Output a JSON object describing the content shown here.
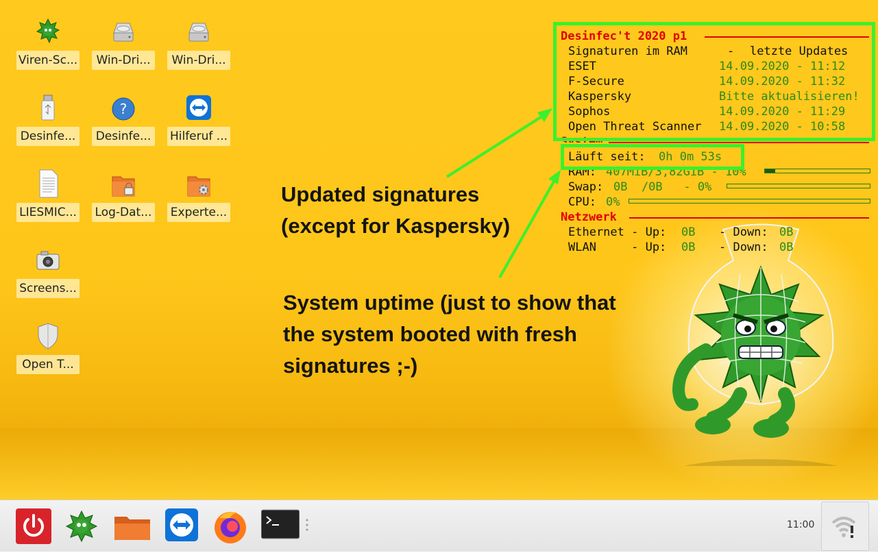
{
  "desktop_icons": [
    {
      "label": "Viren-Sc...",
      "icon": "virus-mascot-icon"
    },
    {
      "label": "Win-Dri...",
      "icon": "hard-drive-icon"
    },
    {
      "label": "Win-Dri...",
      "icon": "hard-drive-icon"
    },
    {
      "label": "Desinfe...",
      "icon": "usb-stick-icon"
    },
    {
      "label": "Desinfe...",
      "icon": "help-icon"
    },
    {
      "label": "Hilferuf ...",
      "icon": "teamviewer-icon"
    },
    {
      "label": "LIESMIC...",
      "icon": "text-document-icon"
    },
    {
      "label": "Log-Dat...",
      "icon": "locked-folder-icon"
    },
    {
      "label": "Experte...",
      "icon": "settings-folder-icon"
    },
    {
      "label": "Screens...",
      "icon": "camera-icon"
    },
    {
      "label": "Open T...",
      "icon": "shield-icon"
    }
  ],
  "conky": {
    "title": "Desinfec't 2020 p1",
    "sig_header_left": "Signaturen im RAM",
    "sig_header_sep": "-",
    "sig_header_right": "letzte Updates",
    "signatures": [
      {
        "name": "ESET",
        "value": "14.09.2020 - 11:12"
      },
      {
        "name": "F-Secure",
        "value": "14.09.2020 - 11:32"
      },
      {
        "name": "Kaspersky",
        "value": "Bitte aktualisieren!"
      },
      {
        "name": "Sophos",
        "value": "14.09.2020 - 11:29"
      },
      {
        "name": "Open Threat Scanner",
        "value": "14.09.2020 - 10:58"
      }
    ],
    "system_heading": "System",
    "uptime_label": "Läuft seit:",
    "uptime_value": "0h 0m 53s",
    "ram_label": "RAM:",
    "ram_value": "407MiB/3,82GiB - 10%",
    "ram_percent": 10,
    "swap_label": "Swap:",
    "swap_value": "0B  /0B   - 0%",
    "swap_percent": 0,
    "cpu_label": "CPU:",
    "cpu_value": "0%",
    "cpu_percent": 0,
    "network_heading": "Netzwerk",
    "ethernet_label": "Ethernet - Up:",
    "ethernet_up": "0B",
    "ethernet_down_label": "- Down:",
    "ethernet_down": "0B",
    "wlan_label": "WLAN     - Up:",
    "wlan_up": "0B",
    "wlan_down_label": "- Down:",
    "wlan_down": "0B"
  },
  "annotations": {
    "signatures_note": "Updated signatures\n(except for Kaspersky)",
    "uptime_note": "System uptime (just to show that\nthe system booted with fresh\nsignatures ;-)"
  },
  "taskbar": {
    "apps": [
      "power-icon",
      "virus-scanner-icon",
      "file-manager-icon",
      "teamviewer-icon",
      "firefox-icon",
      "terminal-icon"
    ],
    "clock": "11:00",
    "network_status": "wifi-disconnected-icon"
  },
  "colors": {
    "wallpaper": "#ffc61a",
    "conky_heading": "#e00000",
    "conky_value": "#2c8a1a",
    "highlight": "#3cf02c"
  }
}
